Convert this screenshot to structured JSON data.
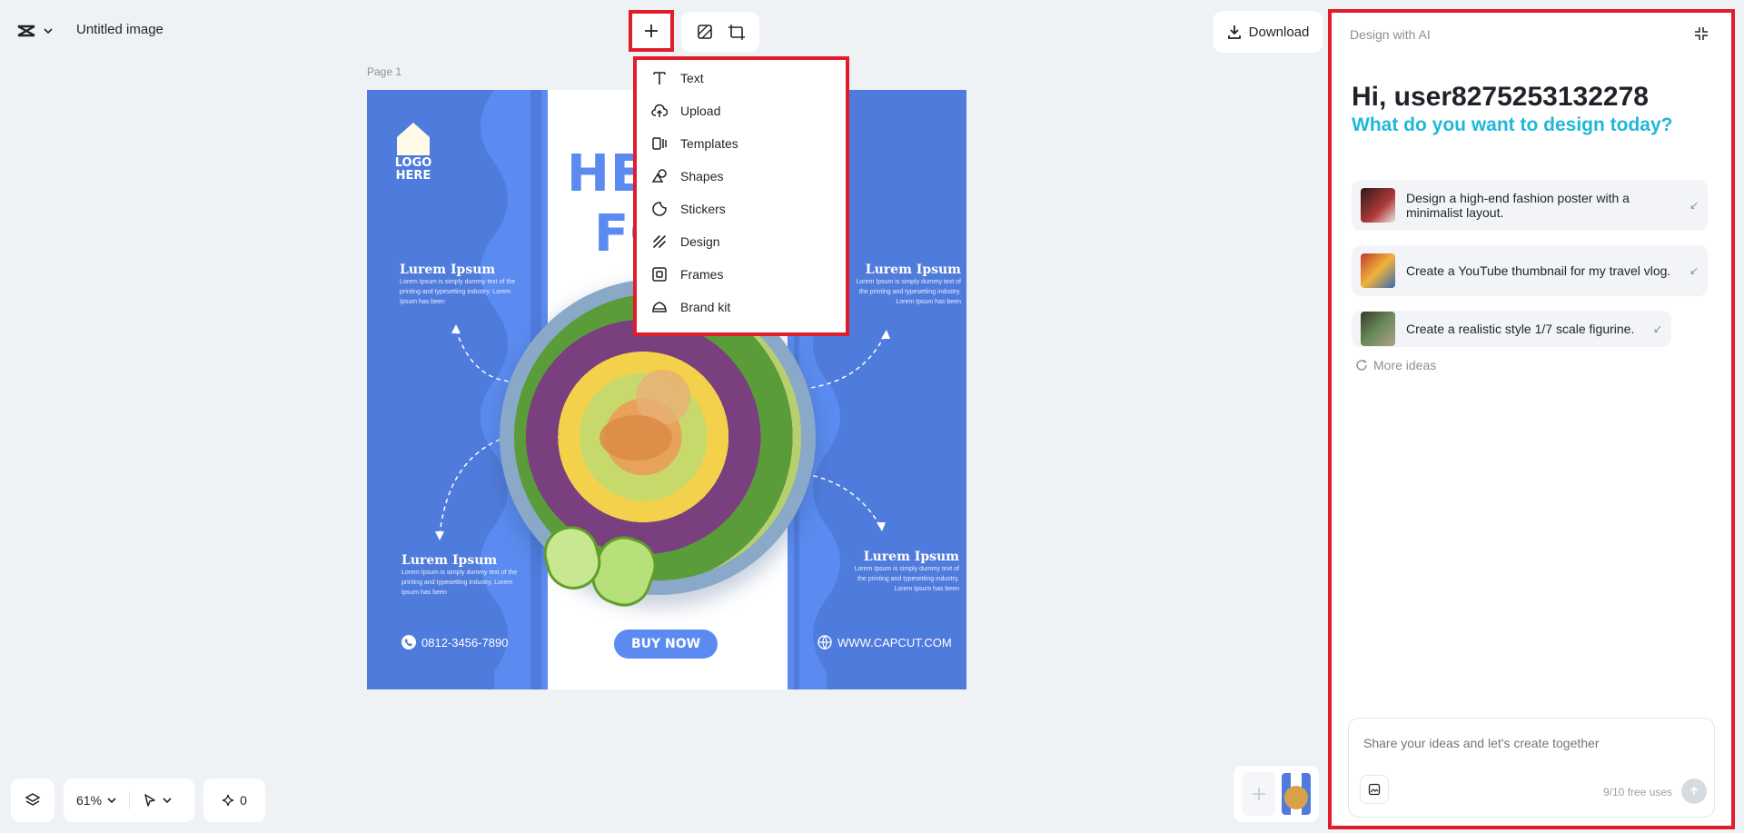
{
  "header": {
    "doc_title": "Untitled image",
    "download_label": "Download"
  },
  "page": {
    "label": "Page 1"
  },
  "canvas": {
    "logo_line1": "LOGO",
    "logo_line2": "HERE",
    "headline_line1": "HE",
    "headline_line2": "FO",
    "blocks": [
      {
        "title": "Lurem Ipsum",
        "body": "Lorem Ipsum is simply dummy text of the printing and typesetting industry. Lorem Ipsum has been"
      },
      {
        "title": "Lurem Ipsum",
        "body": "Lorem Ipsum is simply dummy text of the printing and typesetting industry. Lorem Ipsum has been"
      },
      {
        "title": "Lurem Ipsum",
        "body": "Lorem Ipsum is simply dummy text of the printing and typesetting industry. Lorem Ipsum has been"
      },
      {
        "title": "Lurem Ipsum",
        "body": "Lorem Ipsum is simply dummy text of the printing and typesetting industry. Lorem Ipsum has been"
      }
    ],
    "phone": "0812-3456-7890",
    "buy_now": "BUY NOW",
    "website": "WWW.CAPCUT.COM"
  },
  "menu": {
    "items": [
      {
        "label": "Text",
        "icon": "text-icon"
      },
      {
        "label": "Upload",
        "icon": "upload-icon"
      },
      {
        "label": "Templates",
        "icon": "templates-icon"
      },
      {
        "label": "Shapes",
        "icon": "shapes-icon"
      },
      {
        "label": "Stickers",
        "icon": "stickers-icon"
      },
      {
        "label": "Design",
        "icon": "design-icon"
      },
      {
        "label": "Frames",
        "icon": "frames-icon"
      },
      {
        "label": "Brand kit",
        "icon": "brand-kit-icon"
      }
    ]
  },
  "bottom": {
    "zoom": "61%",
    "credits": "0"
  },
  "ai_panel": {
    "header": "Design with AI",
    "greeting": "Hi, user8275253132278",
    "question": "What do you want to design today?",
    "suggestions": [
      {
        "text": "Design a high-end fashion poster with a minimalist layout."
      },
      {
        "text": "Create a YouTube thumbnail for my travel vlog."
      },
      {
        "text": "Create a realistic style 1/7 scale figurine."
      }
    ],
    "more_ideas": "More ideas",
    "input_placeholder": "Share your ideas and let's create together",
    "free_uses": "9/10 free uses"
  },
  "colors": {
    "accent_cyan": "#1fb8d8",
    "canvas_blue": "#4f7bdc",
    "highlight_red": "#e01d2a"
  }
}
